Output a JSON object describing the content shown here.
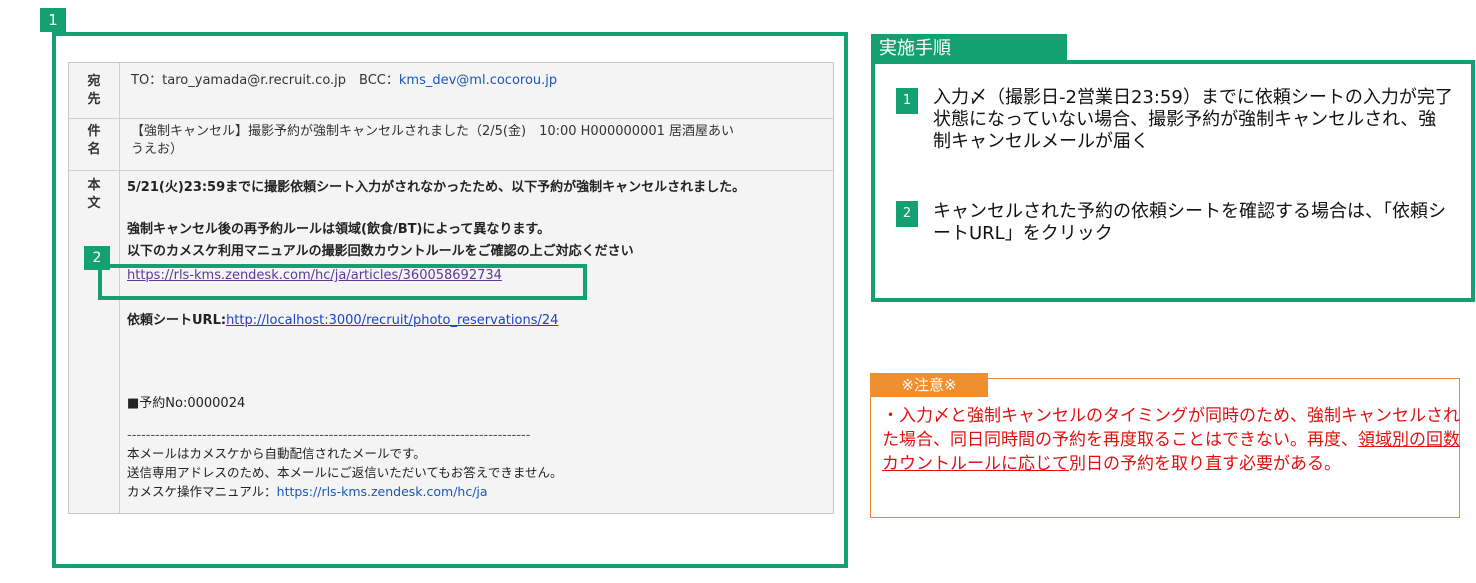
{
  "badges": {
    "frame": "1",
    "link": "2"
  },
  "email": {
    "to_label": "宛\n先",
    "to_line_prefix": "TO：taro_yamada@r.recruit.co.jp　BCC：",
    "bcc_address": "kms_dev@ml.cocorou.jp",
    "subject_label": "件\n名",
    "subject_line1": "【強制キャンセル】撮影予約が強制キャンセルされました（2/5(金)　10:00 H000000001 居酒屋あい",
    "subject_line2": "うえお）",
    "body_label": "本\n文",
    "body_line1": "5/21(火)23:59までに撮影依頼シート入力がされなかったため、以下予約が強制キャンセルされました。",
    "body_line2": "強制キャンセル後の再予約ルールは領域(飲食/BT)によって異なります。",
    "body_line3": "以下のカメスケ利用マニュアルの撮影回数カウントルールをご確認の上ご対応ください",
    "body_link": "https://rls-kms.zendesk.com/hc/ja/articles/360058692734",
    "sheet_url_label": "依頼シートURL:",
    "sheet_url": "http://localhost:3000/recruit/photo_reservations/24",
    "reservation_no": "■予約No:0000024",
    "divider": "--------------------------------------------------------------------------------------",
    "footer_line1": "本メールはカメスケから自動配信されたメールです。",
    "footer_line2": "送信専用アドレスのため、本メールにご返信いただいてもお答えできません。",
    "footer_line3_prefix": "カメスケ操作マニュアル：",
    "footer_manual_link": "https://rls-kms.zendesk.com/hc/ja"
  },
  "steps": {
    "title": "実施手順",
    "items": [
      {
        "num": "1",
        "text": "入力〆（撮影日-2営業日23:59）までに依頼シートの入力が完了状態になっていない場合、撮影予約が強制キャンセルされ、強制キャンセルメールが届く"
      },
      {
        "num": "2",
        "text": "キャンセルされた予約の依頼シートを確認する場合は、「依頼シートURL」をクリック"
      }
    ]
  },
  "note": {
    "title": "※注意※",
    "text_before": "・入力〆と強制キャンセルのタイミングが同時のため、強制キャンセルされた場合、同日同時間の予約を再度取ることはできない。再度、",
    "text_underlined": "領域別の回数カウントルールに応じて",
    "text_after": "別日の予約を取り直す必要がある。"
  },
  "colors": {
    "accent_green": "#15a072",
    "note_orange": "#ef8f2f",
    "note_red": "#e21010"
  }
}
